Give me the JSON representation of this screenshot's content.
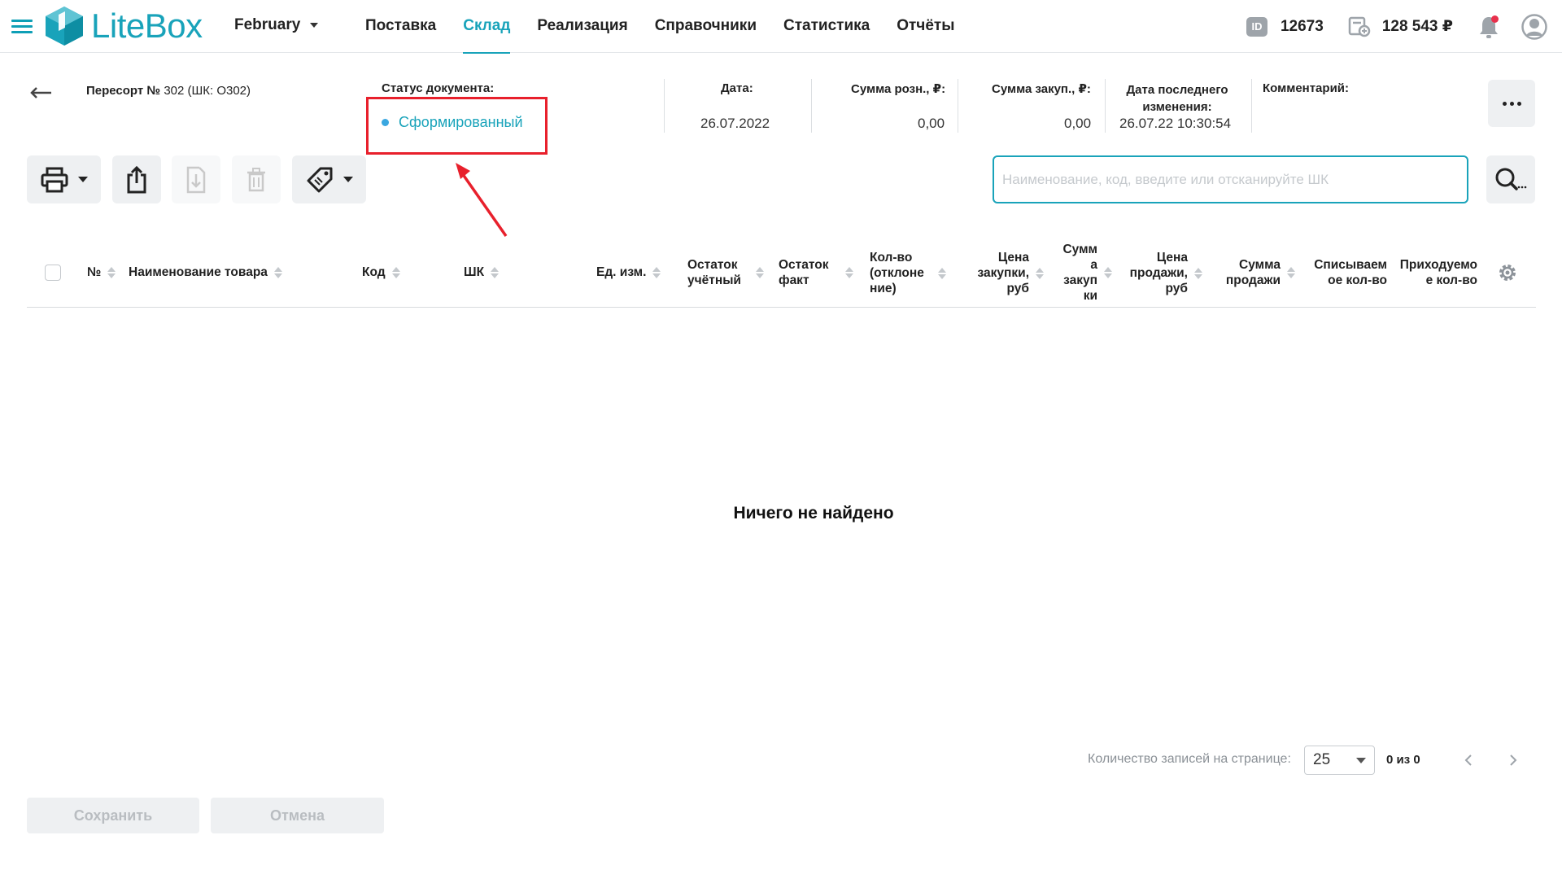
{
  "app": {
    "logo_text": "LiteBox",
    "period": "February",
    "brand_color": "#19a3ba"
  },
  "nav": {
    "items": [
      {
        "label": "Поставка",
        "active": false
      },
      {
        "label": "Склад",
        "active": true
      },
      {
        "label": "Реализация",
        "active": false
      },
      {
        "label": "Справочники",
        "active": false
      },
      {
        "label": "Статистика",
        "active": false
      },
      {
        "label": "Отчёты",
        "active": false
      }
    ]
  },
  "account": {
    "id_badge": "ID",
    "id_value": "12673",
    "balance": "128 543 ₽",
    "has_notification": true
  },
  "document": {
    "title_bold": "Пересорт №",
    "title_rest": "302 (ШК: О302)",
    "status_label": "Статус документа:",
    "status_value": "Сформированный",
    "date_label": "Дата:",
    "date_value": "26.07.2022",
    "retail_sum_label": "Сумма розн., ₽:",
    "retail_sum_value": "0,00",
    "purchase_sum_label": "Сумма закуп., ₽:",
    "purchase_sum_value": "0,00",
    "last_change_label": "Дата последнего изменения:",
    "last_change_value": "26.07.22 10:30:54",
    "comment_label": "Комментарий:"
  },
  "toolbar": {
    "search_placeholder": "Наименование, код, введите или отсканируйте ШК"
  },
  "table": {
    "columns": [
      "№",
      "Наименование товара",
      "Код",
      "ШК",
      "Ед. изм.",
      "Остаток учётный",
      "Остаток факт",
      "Кол-во (отклоне ние)",
      "Цена закупки, руб",
      "Сумм а закуп ки",
      "Цена продажи, руб",
      "Сумма продажи",
      "Списываем ое кол-во",
      "Приходуемо е кол-во"
    ],
    "rows": [],
    "empty_message": "Ничего не найдено"
  },
  "pagination": {
    "label": "Количество записей на странице:",
    "page_size": "25",
    "count": "0 из 0"
  },
  "actions": {
    "save_label": "Сохранить",
    "cancel_label": "Отмена"
  },
  "annotation": {
    "color": "#e8202c"
  }
}
